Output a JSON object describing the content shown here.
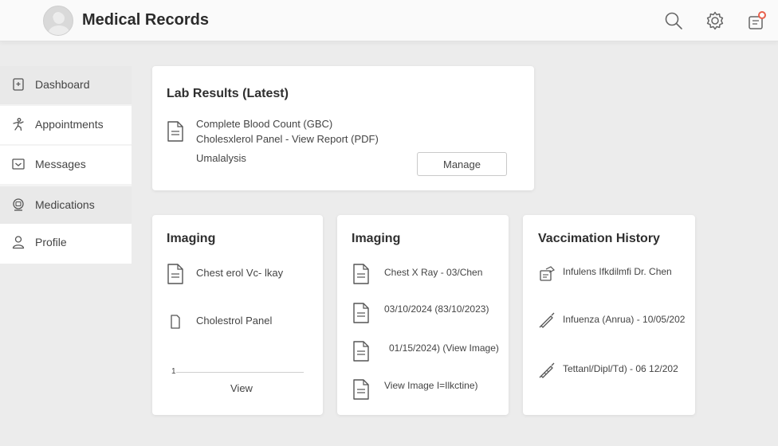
{
  "header": {
    "title": "Medical Records",
    "icons": [
      "search-icon",
      "gear-icon",
      "notification-icon"
    ],
    "accent_color": "#e8604c"
  },
  "sidebar": {
    "items": [
      {
        "label": "Dashboard",
        "icon": "dashboard-icon"
      },
      {
        "label": "Appointments",
        "icon": "person-activity-icon"
      },
      {
        "label": "Messages",
        "icon": "message-icon"
      },
      {
        "label": "Medications",
        "icon": "pill-icon"
      },
      {
        "label": "Profile",
        "icon": "user-icon"
      }
    ]
  },
  "lab_results": {
    "title": "Lab Results (Latest)",
    "lines": [
      "Complete Blood Count (GBC)",
      "Cholesxlerol Panel - View Report (PDF)",
      "Umalalysis"
    ],
    "manage_label": "Manage"
  },
  "imaging_1": {
    "title": "Imaging",
    "items": [
      "Chest erol Vc- lkay",
      "Cholestrol Panel"
    ],
    "marker": "1",
    "view_label": "View"
  },
  "imaging_2": {
    "title": "Imaging",
    "items": [
      "Chest X Ray - 03/Chen",
      "03/10/2024 (83/10/2023)",
      "01/15/2024) (View Image)",
      "View Image I=Ilkctine)"
    ]
  },
  "vaccination": {
    "title": "Vaccimation History",
    "items": [
      "Infulens Ifkdilmfi Dr. Chen",
      "Infuenza (Anrua) - 10/05/202",
      "Tettanl/Dipl/Td) - 06 12/202"
    ]
  }
}
